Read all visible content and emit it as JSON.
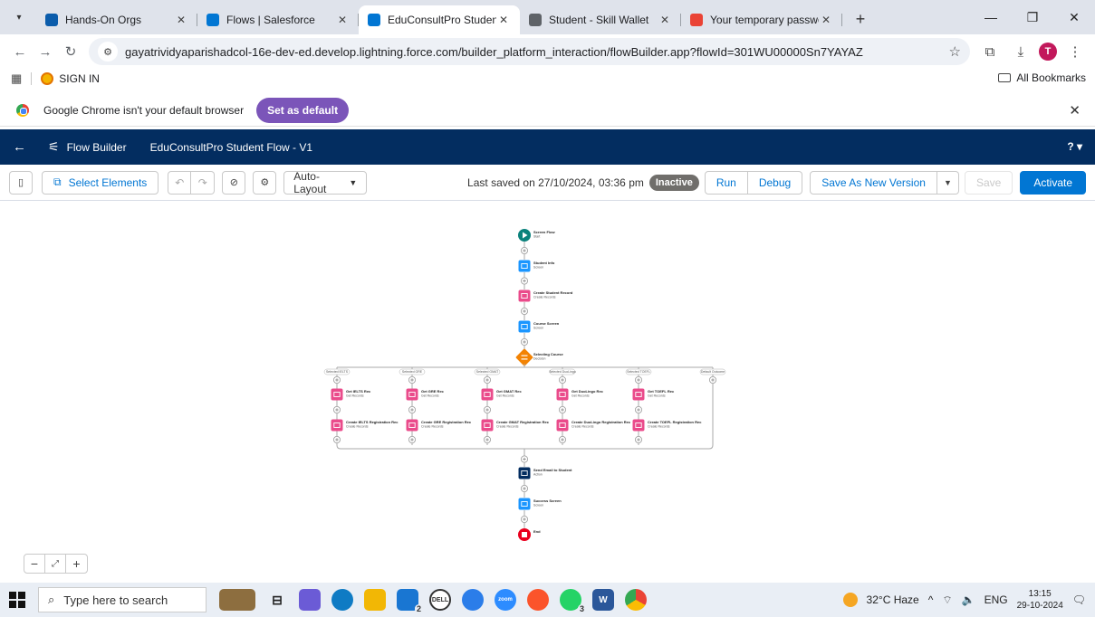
{
  "browser": {
    "tabs": [
      {
        "title": "Hands-On Orgs",
        "favicon_color": "#0b5cab",
        "active": false
      },
      {
        "title": "Flows | Salesforce",
        "favicon_color": "#0176d3",
        "active": false
      },
      {
        "title": "EduConsultPro Student Flow - V",
        "favicon_color": "#0176d3",
        "active": true
      },
      {
        "title": "Student - Skill Wallet",
        "favicon_color": "#5f6368",
        "active": false
      },
      {
        "title": "Your temporary password has b",
        "favicon_color": "#ea4335",
        "active": false
      }
    ],
    "new_tab": "+",
    "url": "gayatrividyaparishadcol-16e-dev-ed.develop.lightning.force.com/builder_platform_interaction/flowBuilder.app?flowId=301WU00000Sn7YAYAZ",
    "avatar_letter": "T",
    "bookmarks": {
      "item": "SIGN IN",
      "all_bookmarks": "All Bookmarks"
    },
    "infobar": {
      "message": "Google Chrome isn't your default browser",
      "button": "Set as default"
    }
  },
  "flow_builder": {
    "app_name": "Flow Builder",
    "flow_title": "EduConsultPro Student Flow - V1",
    "help": "? ▾",
    "toolbar": {
      "select_elements": "Select Elements",
      "auto_layout": "Auto-Layout",
      "last_saved": "Last saved on 27/10/2024, 03:36 pm",
      "status": "Inactive",
      "run": "Run",
      "debug": "Debug",
      "save_as_new_version": "Save As New Version",
      "save": "Save",
      "activate": "Activate"
    },
    "colors": {
      "screen": "#1b96ff",
      "record": "#ea4b8b",
      "decision": "#f38303",
      "action": "#032d60",
      "start": "#0b827c",
      "end": "#ea001e"
    },
    "main_nodes": [
      {
        "title": "Screen Flow",
        "type": "Start",
        "kind": "start"
      },
      {
        "title": "Student Info",
        "type": "Screen",
        "kind": "screen"
      },
      {
        "title": "Create Student Record",
        "type": "Create Records",
        "kind": "record"
      },
      {
        "title": "Course Screen",
        "type": "Screen",
        "kind": "screen"
      },
      {
        "title": "Selecting Course",
        "type": "Decision",
        "kind": "decision"
      }
    ],
    "branches": [
      {
        "label": "Selected IELTS",
        "get": "Get IELTS Rec",
        "create": "Create IELTS Registration Rec"
      },
      {
        "label": "Selected GRE",
        "get": "Get GRE Rec",
        "create": "Create GRE Registration Rec"
      },
      {
        "label": "Selected GMAT",
        "get": "Get GMAT Rec",
        "create": "Create GMAT Registration Rec"
      },
      {
        "label": "Selected DuoLingo",
        "get": "Get DuoLingo Rec",
        "create": "Create DuoLingo Registration Rec"
      },
      {
        "label": "Selected TOEFL",
        "get": "Get TOEFL Rec",
        "create": "Create TOEFL Registration Rec"
      },
      {
        "label": "Default Outcome",
        "get": "",
        "create": ""
      }
    ],
    "branch_get_type": "Get Records",
    "branch_create_type": "Create Records",
    "tail_nodes": [
      {
        "title": "Send Email to Student",
        "type": "Action",
        "kind": "action"
      },
      {
        "title": "Success Screen",
        "type": "Screen",
        "kind": "screen"
      },
      {
        "title": "End",
        "type": "",
        "kind": "end"
      }
    ]
  },
  "taskbar": {
    "search_placeholder": "Type here to search",
    "weather": "32°C Haze",
    "language": "ENG",
    "time": "13:15",
    "date": "29-10-2024",
    "badges": {
      "mail": "2",
      "whatsapp": "3"
    }
  }
}
